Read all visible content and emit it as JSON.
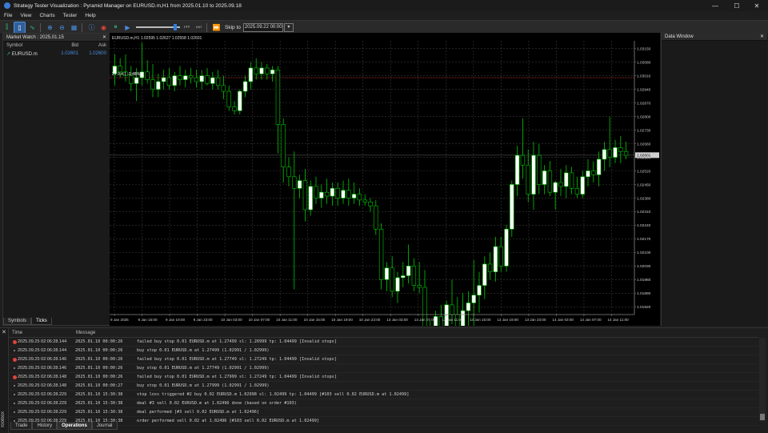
{
  "window": {
    "title": "Strategy Tester Visualization : Pyramid Manager on EURUSD.m,H1 from 2025.01.10 to 2025.09.18",
    "minimize_glyph": "—",
    "maximize_glyph": "☐",
    "close_glyph": "✕"
  },
  "menu": [
    "File",
    "View",
    "Charts",
    "Tester",
    "Help"
  ],
  "toolbar": {
    "skip_label": "Skip to",
    "skip_date": "2025.09.22 00:00",
    "speed_fraction": 0.92
  },
  "market_watch": {
    "title": "Market Watch : 2025.01.15",
    "columns": [
      "Symbol",
      "Bid",
      "Ask"
    ],
    "rows": [
      {
        "symbol": "EURUSD.m",
        "bid": "1.02601",
        "ask": "1.02600"
      }
    ],
    "tabs": [
      "Symbols",
      "Ticks"
    ],
    "active_tab": "Ticks"
  },
  "chart": {
    "header": "EURUSD.m,H1  1.02595 1.02627 1.02558 1.02601",
    "level_label": "2 / 0.4 1 .0.48%",
    "price_labels": [
      "1.03150",
      "1.03080",
      "1.03010",
      "1.02940",
      "1.02870",
      "1.02800",
      "1.02730",
      "1.02660",
      "1.02590",
      "1.02520",
      "1.02450",
      "1.02380",
      "1.02310",
      "1.02240",
      "1.02170",
      "1.02100",
      "1.02030",
      "1.01960",
      "1.01890",
      "1.01820"
    ],
    "current_price": "1.02601",
    "time_labels": [
      "9 Jan 2025",
      "9 Jan 15:00",
      "9 Jan 19:00",
      "9 Jan 23:00",
      "10 Jan 03:00",
      "10 Jan 07:00",
      "10 Jan 11:00",
      "10 Jan 15:00",
      "10 Jan 19:00",
      "10 Jan 23:00",
      "13 Jan 03:00",
      "13 Jan 07:00",
      "13 Jan 11:00",
      "13 Jan 15:00",
      "13 Jan 19:00",
      "13 Jan 23:00",
      "14 Jan 03:00",
      "14 Jan 07:00",
      "14 Jan 11:00"
    ],
    "colors": {
      "bull": "#ffffff",
      "bear": "#000000",
      "wick": "#00c800",
      "grid": "#3a3a3a",
      "current_line": "#666666",
      "stop_line": "#b03a2e"
    }
  },
  "chart_data": {
    "type": "candlestick",
    "symbol": "EURUSD.m",
    "timeframe": "H1",
    "ylim": [
      1.0178,
      1.0319
    ],
    "ohlc": [
      [
        1.0302,
        1.0312,
        1.0296,
        1.0306
      ],
      [
        1.0306,
        1.031,
        1.03,
        1.0303
      ],
      [
        1.0303,
        1.0312,
        1.0298,
        1.0301
      ],
      [
        1.0301,
        1.0306,
        1.0293,
        1.0297
      ],
      [
        1.0297,
        1.0305,
        1.0288,
        1.03
      ],
      [
        1.03,
        1.0318,
        1.0296,
        1.0303
      ],
      [
        1.0303,
        1.0309,
        1.0297,
        1.0299
      ],
      [
        1.0299,
        1.0307,
        1.029,
        1.0294
      ],
      [
        1.0294,
        1.0302,
        1.029,
        1.0298
      ],
      [
        1.0298,
        1.0304,
        1.0294,
        1.03
      ],
      [
        1.03,
        1.0305,
        1.0294,
        1.0296
      ],
      [
        1.0296,
        1.0303,
        1.0293,
        1.0301
      ],
      [
        1.0301,
        1.0306,
        1.0296,
        1.0299
      ],
      [
        1.0299,
        1.0304,
        1.0295,
        1.0301
      ],
      [
        1.0301,
        1.0305,
        1.0297,
        1.03
      ],
      [
        1.03,
        1.0304,
        1.0295,
        1.0298
      ],
      [
        1.0298,
        1.0304,
        1.0294,
        1.0301
      ],
      [
        1.0301,
        1.0305,
        1.0296,
        1.0297
      ],
      [
        1.0297,
        1.0303,
        1.0294,
        1.03
      ],
      [
        1.03,
        1.0304,
        1.0294,
        1.0296
      ],
      [
        1.0296,
        1.0301,
        1.0289,
        1.0293
      ],
      [
        1.0293,
        1.0296,
        1.0283,
        1.0285
      ],
      [
        1.0285,
        1.0288,
        1.0281,
        1.0283
      ],
      [
        1.0283,
        1.0294,
        1.0281,
        1.0293
      ],
      [
        1.0293,
        1.0301,
        1.029,
        1.0298
      ],
      [
        1.0298,
        1.0308,
        1.0294,
        1.0305
      ],
      [
        1.0305,
        1.031,
        1.0299,
        1.0302
      ],
      [
        1.0302,
        1.0308,
        1.0299,
        1.0305
      ],
      [
        1.0305,
        1.0307,
        1.0299,
        1.0302
      ],
      [
        1.0302,
        1.0306,
        1.0298,
        1.0304
      ],
      [
        1.0304,
        1.0306,
        1.0261,
        1.0276
      ],
      [
        1.0276,
        1.0279,
        1.0246,
        1.0254
      ],
      [
        1.0254,
        1.0259,
        1.0244,
        1.0249
      ],
      [
        1.0249,
        1.0262,
        1.0191,
        1.0243
      ],
      [
        1.0243,
        1.025,
        1.0238,
        1.0247
      ],
      [
        1.0247,
        1.0253,
        1.0226,
        1.0232
      ],
      [
        1.0232,
        1.0247,
        1.0229,
        1.0244
      ],
      [
        1.0244,
        1.0249,
        1.0235,
        1.0238
      ],
      [
        1.0238,
        1.0245,
        1.0233,
        1.0241
      ],
      [
        1.0241,
        1.0248,
        1.0235,
        1.0239
      ],
      [
        1.0239,
        1.0246,
        1.0234,
        1.0243
      ],
      [
        1.0243,
        1.0246,
        1.0234,
        1.0238
      ],
      [
        1.0238,
        1.0247,
        1.0235,
        1.0242
      ],
      [
        1.0242,
        1.0248,
        1.0234,
        1.0238
      ],
      [
        1.0238,
        1.0246,
        1.0235,
        1.024
      ],
      [
        1.024,
        1.0243,
        1.0234,
        1.0237
      ],
      [
        1.0237,
        1.024,
        1.0234,
        1.0236
      ],
      [
        1.0236,
        1.0238,
        1.0231,
        1.0234
      ],
      [
        1.0234,
        1.0237,
        1.0219,
        1.0222
      ],
      [
        1.0222,
        1.0225,
        1.0191,
        1.0196
      ],
      [
        1.0196,
        1.0205,
        1.019,
        1.0202
      ],
      [
        1.0202,
        1.0208,
        1.0187,
        1.019
      ],
      [
        1.019,
        1.02,
        1.0184,
        1.0197
      ],
      [
        1.0197,
        1.0205,
        1.0192,
        1.0198
      ],
      [
        1.0198,
        1.0214,
        1.0194,
        1.0203
      ],
      [
        1.0203,
        1.0207,
        1.019,
        1.0193
      ],
      [
        1.0193,
        1.0205,
        1.0189,
        1.0192
      ],
      [
        1.0192,
        1.0201,
        1.0178,
        1.0165
      ],
      [
        1.0165,
        1.0175,
        1.0156,
        1.017
      ],
      [
        1.017,
        1.018,
        1.0162,
        1.0177
      ],
      [
        1.0177,
        1.0183,
        1.0168,
        1.0172
      ],
      [
        1.0172,
        1.0185,
        1.0167,
        1.0183
      ],
      [
        1.0183,
        1.0196,
        1.0173,
        1.0178
      ],
      [
        1.0178,
        1.0187,
        1.0165,
        1.0172
      ],
      [
        1.0172,
        1.0189,
        1.0166,
        1.018
      ],
      [
        1.018,
        1.019,
        1.0172,
        1.0184
      ],
      [
        1.0184,
        1.0206,
        1.0171,
        1.0188
      ],
      [
        1.0188,
        1.02,
        1.0179,
        1.0193
      ],
      [
        1.0193,
        1.0208,
        1.0186,
        1.0204
      ],
      [
        1.0204,
        1.021,
        1.0196,
        1.02
      ],
      [
        1.02,
        1.0218,
        1.0195,
        1.0213
      ],
      [
        1.0213,
        1.0218,
        1.02,
        1.0203
      ],
      [
        1.0203,
        1.0224,
        1.02,
        1.0222
      ],
      [
        1.0222,
        1.0247,
        1.0218,
        1.0245
      ],
      [
        1.0245,
        1.0265,
        1.0239,
        1.026
      ],
      [
        1.026,
        1.0279,
        1.0248,
        1.0255
      ],
      [
        1.0255,
        1.0263,
        1.0236,
        1.024
      ],
      [
        1.024,
        1.0267,
        1.0232,
        1.026
      ],
      [
        1.026,
        1.0266,
        1.024,
        1.0245
      ],
      [
        1.0245,
        1.0255,
        1.024,
        1.0252
      ],
      [
        1.0252,
        1.0257,
        1.0239,
        1.0241
      ],
      [
        1.0241,
        1.0247,
        1.0232,
        1.0246
      ],
      [
        1.0246,
        1.0253,
        1.0239,
        1.0244
      ],
      [
        1.0244,
        1.0255,
        1.0238,
        1.0251
      ],
      [
        1.0251,
        1.0254,
        1.024,
        1.0243
      ],
      [
        1.0243,
        1.0249,
        1.0238,
        1.024
      ],
      [
        1.024,
        1.0252,
        1.0238,
        1.0249
      ],
      [
        1.0249,
        1.0258,
        1.0244,
        1.0252
      ],
      [
        1.0252,
        1.0257,
        1.0246,
        1.025
      ],
      [
        1.025,
        1.0262,
        1.0244,
        1.0258
      ],
      [
        1.0258,
        1.0267,
        1.0252,
        1.0263
      ],
      [
        1.0263,
        1.028,
        1.0254,
        1.0259
      ],
      [
        1.0259,
        1.0268,
        1.0256,
        1.0264
      ],
      [
        1.0264,
        1.027,
        1.0256,
        1.0262
      ],
      [
        1.0262,
        1.0267,
        1.0258,
        1.026
      ]
    ]
  },
  "data_window": {
    "title": "Data Window"
  },
  "log": {
    "columns": [
      "Time",
      "Message"
    ],
    "rows": [
      {
        "level": "error",
        "time": "2025.09.25 02:06:28.144",
        "src": "2025.01.10 00:00:26",
        "msg": "failed buy stop 0.01 EURUSD.m at 1.27499 sl: 1.26999 tp: 1.04499 [Invalid stops]"
      },
      {
        "level": "info",
        "time": "2025.09.25 02:06:28.144",
        "src": "2025.01.10 00:00:26",
        "msg": "buy stop 0.01 EURUSD.m at 1.27499 (1.02991 / 1.02999)"
      },
      {
        "level": "error",
        "time": "2025.09.25 02:06:28.146",
        "src": "2025.01.10 00:00:26",
        "msg": "failed buy stop 0.01 EURUSD.m at 1.27749 sl: 1.27249 tp: 1.04499 [Invalid stops]"
      },
      {
        "level": "info",
        "time": "2025.09.25 02:06:28.146",
        "src": "2025.01.10 00:00:26",
        "msg": "buy stop 0.01 EURUSD.m at 1.27749 (1.02991 / 1.02999)"
      },
      {
        "level": "error",
        "time": "2025.09.25 02:06:28.148",
        "src": "2025.01.10 00:00:26",
        "msg": "failed buy stop 0.01 EURUSD.m at 1.27999 sl: 1.27249 tp: 1.04499 [Invalid stops]"
      },
      {
        "level": "info",
        "time": "2025.09.25 02:06:28.148",
        "src": "2025.01.10 00:00:27",
        "msg": "buy stop 0.01 EURUSD.m at 1.27999 (1.02991 / 1.02999)"
      },
      {
        "level": "info",
        "time": "2025.09.25 02:06:28.229",
        "src": "2025.01.10 15:30:38",
        "msg": "stop loss triggered #2 buy 0.02 EURUSD.m 1.02998 sl: 1.02499 tp: 1.04499 [#103 sell 0.02 EURUSD.m at 1.02499]"
      },
      {
        "level": "info",
        "time": "2025.09.25 02:06:28.229",
        "src": "2025.01.10 15:30:38",
        "msg": "deal #3 sell 0.02 EURUSD.m at 1.02496 done (based on order #103)"
      },
      {
        "level": "info",
        "time": "2025.09.25 02:06:28.229",
        "src": "2025.01.10 15:30:38",
        "msg": "deal performed [#3 sell 0.02 EURUSD.m at 1.02496]"
      },
      {
        "level": "info",
        "time": "2025.09.25 02:06:28.229",
        "src": "2025.01.10 15:30:38",
        "msg": "order performed sell 0.02 at 1.02496 [#103 sell 0.02 EURUSD.m at 1.02499]"
      }
    ],
    "tabs": [
      "Trade",
      "History",
      "Operations",
      "Journal"
    ],
    "active_tab": "Operations"
  },
  "toolbox": {
    "side_label": "Toolbox",
    "close_glyph": "✕"
  }
}
